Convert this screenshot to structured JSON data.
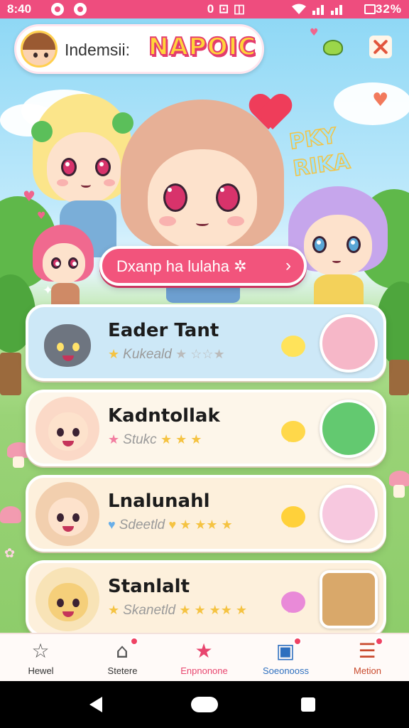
{
  "status_bar": {
    "time": "8:40",
    "right_text": "0 ⊡ ◫",
    "battery": "32%",
    "icons": [
      "notification-dot-icon",
      "heart-notification-icon",
      "mute-icon",
      "alarm-icon",
      "wifi-icon",
      "signal-icon",
      "battery-icon"
    ]
  },
  "header": {
    "player_name": "Indemsii:",
    "logo_text": "NAPOIC"
  },
  "hero": {
    "deco_text_line1": "PKY",
    "deco_text_line2": "RIKA",
    "cta_label": "Dxanp ha lulaha ✲",
    "cta_chevron": "›"
  },
  "cards": [
    {
      "title": "Eader Tant",
      "subtitle": "Kukeald",
      "stars": "★ ☆☆★",
      "avatar_icon": "gray-cat-icon",
      "bubble_color": "#ffe35a",
      "thumb_icon": "pink-blob-icon"
    },
    {
      "title": "Kadntollak",
      "subtitle": "Stukc",
      "stars": "★ ★ ★",
      "avatar_icon": "blonde-girl-icon",
      "bubble_color": "#ffd84a",
      "thumb_icon": "green-frog-icon"
    },
    {
      "title": "Lnalunahl",
      "subtitle": "Sdeetld",
      "stars": "♥ ★ ★★ ★",
      "avatar_icon": "brunette-girl-icon",
      "bubble_color": "#ffd13a",
      "thumb_icon": "flower-girl-icon"
    },
    {
      "title": "Stanlalt",
      "subtitle": "Skanetld",
      "stars": "★ ★ ★★ ★",
      "avatar_icon": "yellow-dog-icon",
      "bubble_color": "#e98ad8",
      "thumb_icon": "framed-girl-icon"
    }
  ],
  "bottom_nav": [
    {
      "label": "Hewel",
      "icon": "star-outline-icon",
      "color": "#333333",
      "badge": false
    },
    {
      "label": "Stetere",
      "icon": "tag-icon",
      "color": "#333333",
      "badge": true
    },
    {
      "label": "Enpnonone",
      "icon": "pink-star-icon",
      "color": "#e8456e",
      "badge": false
    },
    {
      "label": "Soeonooss",
      "icon": "framed-picture-icon",
      "color": "#2d6fbf",
      "badge": true
    },
    {
      "label": "Metion",
      "icon": "list-menu-icon",
      "color": "#c94a2d",
      "badge": true
    }
  ],
  "colors": {
    "status_bar": "#ee4d7e",
    "accent_pink": "#f2547c",
    "logo_yellow": "#ffd43a"
  }
}
